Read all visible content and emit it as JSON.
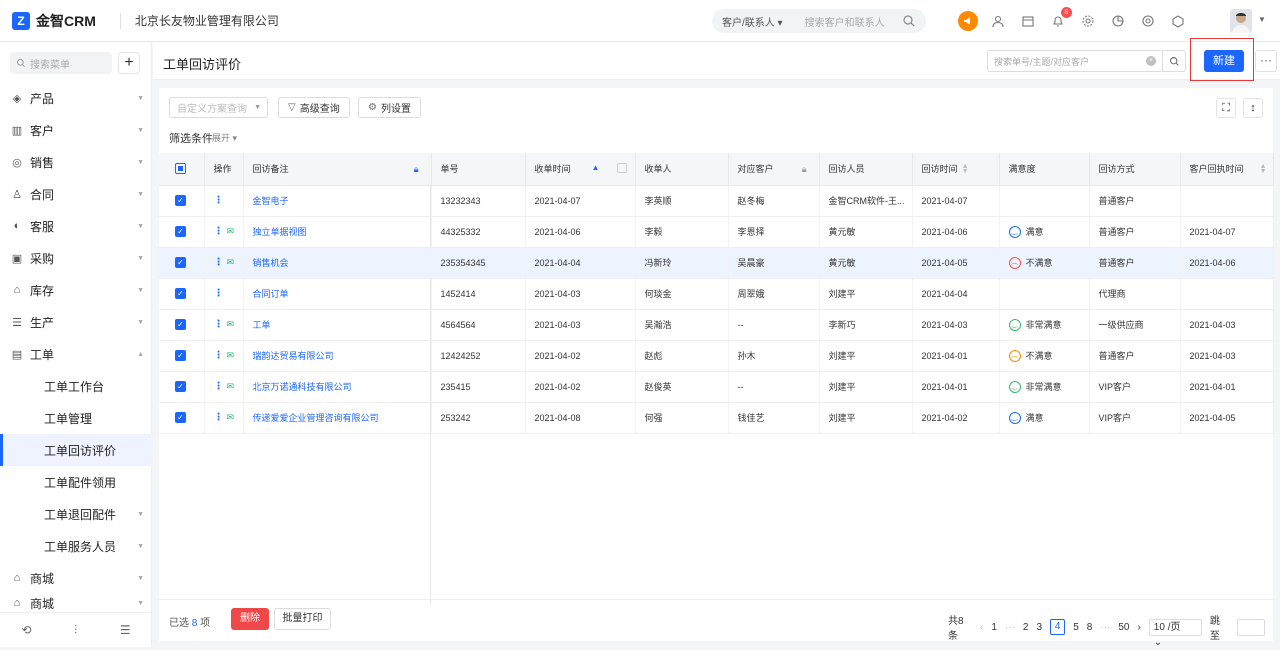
{
  "app": {
    "logo_mark": "Z",
    "logo_text": "金智CRM",
    "company": "北京长友物业管理有限公司"
  },
  "global_search": {
    "type": "客户/联系人",
    "placeholder": "搜索客户和联系人"
  },
  "notifications": {
    "badge": "8"
  },
  "sidebar": {
    "search_placeholder": "搜索菜单",
    "add": "+",
    "items": [
      {
        "label": "产品",
        "icon": "cube-icon"
      },
      {
        "label": "客户",
        "icon": "building-icon"
      },
      {
        "label": "销售",
        "icon": "target-icon"
      },
      {
        "label": "合同",
        "icon": "person-icon"
      },
      {
        "label": "客服",
        "icon": "headset-icon"
      },
      {
        "label": "采购",
        "icon": "bag-icon"
      },
      {
        "label": "库存",
        "icon": "warehouse-icon"
      },
      {
        "label": "生产",
        "icon": "factory-icon"
      },
      {
        "label": "工单",
        "icon": "document-icon"
      }
    ],
    "sub_items": [
      {
        "label": "工单工作台"
      },
      {
        "label": "工单管理"
      },
      {
        "label": "工单回访评价"
      },
      {
        "label": "工单配件领用"
      },
      {
        "label": "工单退回配件"
      },
      {
        "label": "工单服务人员"
      }
    ],
    "bottom_items": [
      {
        "label": "商城",
        "icon": "shop-icon"
      },
      {
        "label": "商城",
        "icon": "shop-icon"
      }
    ]
  },
  "page": {
    "title": "工单回访评价",
    "search_placeholder": "搜索单号/主题/对应客户",
    "new_label": "新建",
    "more_label": "···"
  },
  "toolbar": {
    "scheme_placeholder": "自定义方案查询",
    "advanced_query": "高级查询",
    "column_settings": "列设置",
    "filter_label": "筛选条件",
    "expand_label": "展开"
  },
  "table": {
    "headers": [
      "操作",
      "回访备注",
      "单号",
      "收单时间",
      "收单人",
      "对应客户",
      "回访人员",
      "回访时间",
      "满意度",
      "回访方式",
      "客户回执时间"
    ],
    "rows": [
      {
        "note": "金智电子",
        "no": "13232343",
        "recv_time": "2021-04-07",
        "receiver": "李英顺",
        "customer": "赵冬梅",
        "visitor": "金智CRM软件-王...",
        "visit_time": "2021-04-07",
        "satisfaction": "",
        "face": "",
        "method": "普通客户",
        "reply_time": ""
      },
      {
        "note": "独立单据视图",
        "no": "44325332",
        "recv_time": "2021-04-06",
        "receiver": "李毅",
        "customer": "李恩择",
        "visitor": "黄元敏",
        "visit_time": "2021-04-06",
        "satisfaction": "满意",
        "face": "blue",
        "method": "普通客户",
        "reply_time": "2021-04-07"
      },
      {
        "note": "销售机会",
        "no": "235354345",
        "recv_time": "2021-04-04",
        "receiver": "冯新玲",
        "customer": "吴晨豪",
        "visitor": "黄元敏",
        "visit_time": "2021-04-05",
        "satisfaction": "不满意",
        "face": "red",
        "method": "普通客户",
        "reply_time": "2021-04-06"
      },
      {
        "note": "合同订单",
        "no": "1452414",
        "recv_time": "2021-04-03",
        "receiver": "何琰金",
        "customer": "周翠娥",
        "visitor": "刘建平",
        "visit_time": "2021-04-04",
        "satisfaction": "",
        "face": "",
        "method": "代理商",
        "reply_time": ""
      },
      {
        "note": "工单",
        "no": "4564564",
        "recv_time": "2021-04-03",
        "receiver": "吴瀚浩",
        "customer": "--",
        "visitor": "李新巧",
        "visit_time": "2021-04-03",
        "satisfaction": "非常满意",
        "face": "green",
        "method": "一级供应商",
        "reply_time": "2021-04-03"
      },
      {
        "note": "瑞韵达贸易有限公司",
        "no": "12424252",
        "recv_time": "2021-04-02",
        "receiver": "赵彪",
        "customer": "孙木",
        "visitor": "刘建平",
        "visit_time": "2021-04-01",
        "satisfaction": "不满意",
        "face": "orange",
        "method": "普通客户",
        "reply_time": "2021-04-03"
      },
      {
        "note": "北京万诺通科技有限公司",
        "no": "235415",
        "recv_time": "2021-04-02",
        "receiver": "赵俊英",
        "customer": "--",
        "visitor": "刘建平",
        "visit_time": "2021-04-01",
        "satisfaction": "非常满意",
        "face": "green",
        "method": "VIP客户",
        "reply_time": "2021-04-01"
      },
      {
        "note": "传递爱爱企业管理咨询有限公司",
        "no": "253242",
        "recv_time": "2021-04-08",
        "receiver": "何强",
        "customer": "钱佳艺",
        "visitor": "刘建平",
        "visit_time": "2021-04-02",
        "satisfaction": "满意",
        "face": "blue",
        "method": "VIP客户",
        "reply_time": "2021-04-05"
      }
    ]
  },
  "footer": {
    "selected_prefix": "已选",
    "selected_count": "8",
    "selected_suffix": "项",
    "delete_label": "删除",
    "batch_print_label": "批量打印",
    "total": "共8条",
    "pages": [
      "1",
      "···",
      "2",
      "3",
      "4",
      "5",
      "8",
      "···",
      "50"
    ],
    "current_page": "4",
    "page_size": "10 /页",
    "jump_label": "跳至"
  },
  "colors": {
    "accent": "#1a66ff",
    "danger": "#f04848",
    "success": "#2dbb6a",
    "warning": "#ff8a00"
  }
}
